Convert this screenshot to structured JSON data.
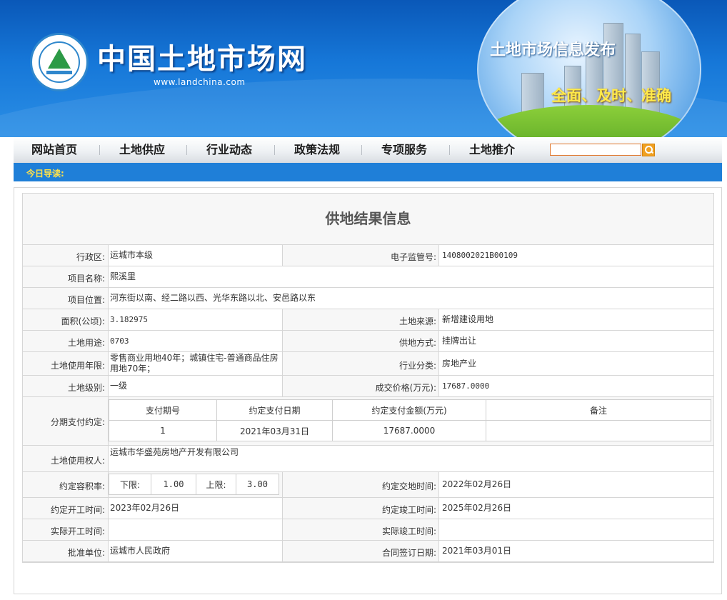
{
  "header": {
    "site_title": "中国土地市场网",
    "site_url": "www.landchina.com",
    "logo_ring_text": "中国土地市场网",
    "logo_bottom_text": "WWW.LANDCHINA.COM",
    "banner_slogan": "土地市场信息发布",
    "banner_tagline": "全面、及时、准确"
  },
  "nav": {
    "items": [
      {
        "label": "网站首页"
      },
      {
        "label": "土地供应"
      },
      {
        "label": "行业动态"
      },
      {
        "label": "政策法规"
      },
      {
        "label": "专项服务"
      },
      {
        "label": "土地推介"
      }
    ],
    "search_value": ""
  },
  "ticker": {
    "label": "今日导读:"
  },
  "record": {
    "title": "供地结果信息",
    "district_label": "行政区:",
    "district": "运城市本级",
    "supervision_no_label": "电子监管号:",
    "supervision_no": "1408002021B00109",
    "project_name_label": "项目名称:",
    "project_name": "熙溪里",
    "project_location_label": "项目位置:",
    "project_location": "河东街以南、经二路以西、光华东路以北、安邑路以东",
    "area_label": "面积(公顷):",
    "area": "3.182975",
    "land_source_label": "土地来源:",
    "land_source": "新增建设用地",
    "land_use_label": "土地用途:",
    "land_use": "0703",
    "supply_method_label": "供地方式:",
    "supply_method": "挂牌出让",
    "use_term_label": "土地使用年限:",
    "use_term": "零售商业用地40年；城镇住宅-普通商品住房用地70年；",
    "industry_label": "行业分类:",
    "industry": "房地产业",
    "land_grade_label": "土地级别:",
    "land_grade": "一级",
    "deal_price_label": "成交价格(万元):",
    "deal_price": "17687.0000",
    "installment_label": "分期支付约定:",
    "installment_headers": [
      "支付期号",
      "约定支付日期",
      "约定支付金额(万元)",
      "备注"
    ],
    "installment_rows": [
      [
        "1",
        "2021年03月31日",
        "17687.0000",
        ""
      ]
    ],
    "holder_label": "土地使用权人:",
    "holder": "运城市华盛苑房地产开发有限公司",
    "far_label": "约定容积率:",
    "far_lower_label": "下限:",
    "far_lower": "1.00",
    "far_upper_label": "上限:",
    "far_upper": "3.00",
    "handover_label": "约定交地时间:",
    "handover": "2022年02月26日",
    "start_label": "约定开工时间:",
    "start": "2023年02月26日",
    "complete_label": "约定竣工时间:",
    "complete": "2025年02月26日",
    "actual_start_label": "实际开工时间:",
    "actual_start": "",
    "actual_complete_label": "实际竣工时间:",
    "actual_complete": "",
    "approver_label": "批准单位:",
    "approver": "运城市人民政府",
    "contract_date_label": "合同签订日期:",
    "contract_date": "2021年03月01日"
  }
}
